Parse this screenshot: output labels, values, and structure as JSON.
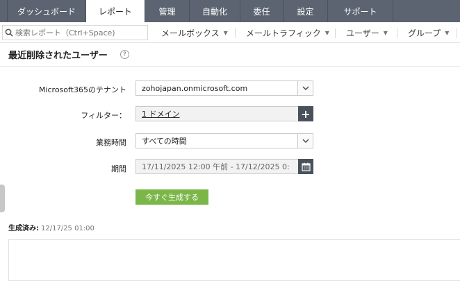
{
  "nav": {
    "tabs": [
      {
        "label": "ダッシュボード"
      },
      {
        "label": "レポート",
        "active": true
      },
      {
        "label": "管理"
      },
      {
        "label": "自動化"
      },
      {
        "label": "委任"
      },
      {
        "label": "設定"
      },
      {
        "label": "サポート"
      }
    ]
  },
  "subbar": {
    "search_placeholder": "検索レポート（Ctrl+Space)",
    "menus": [
      {
        "label": "メールボックス"
      },
      {
        "label": "メールトラフィック"
      },
      {
        "label": "ユーザー"
      },
      {
        "label": "グループ"
      }
    ]
  },
  "page": {
    "title": "最近削除されたユーザー",
    "help_icon": "?"
  },
  "form": {
    "tenant_label": "Microsoft365のテナント",
    "tenant_value": "zohojapan.onmicrosoft.com",
    "filter_label": "フィルター：",
    "filter_value": "1 ドメイン",
    "business_hours_label": "業務時間",
    "business_hours_value": "すべての時間",
    "period_label": "期間",
    "period_value": "17/11/2025 12:00 午前 - 17/12/2025 0:",
    "generate_label": "今すぐ生成する"
  },
  "generated": {
    "label": "生成済み:",
    "value": "12/17/25 01:00"
  },
  "colors": {
    "nav_bg": "#5b6470",
    "generate_btn": "#7ab648",
    "icon_btn": "#49525c"
  }
}
